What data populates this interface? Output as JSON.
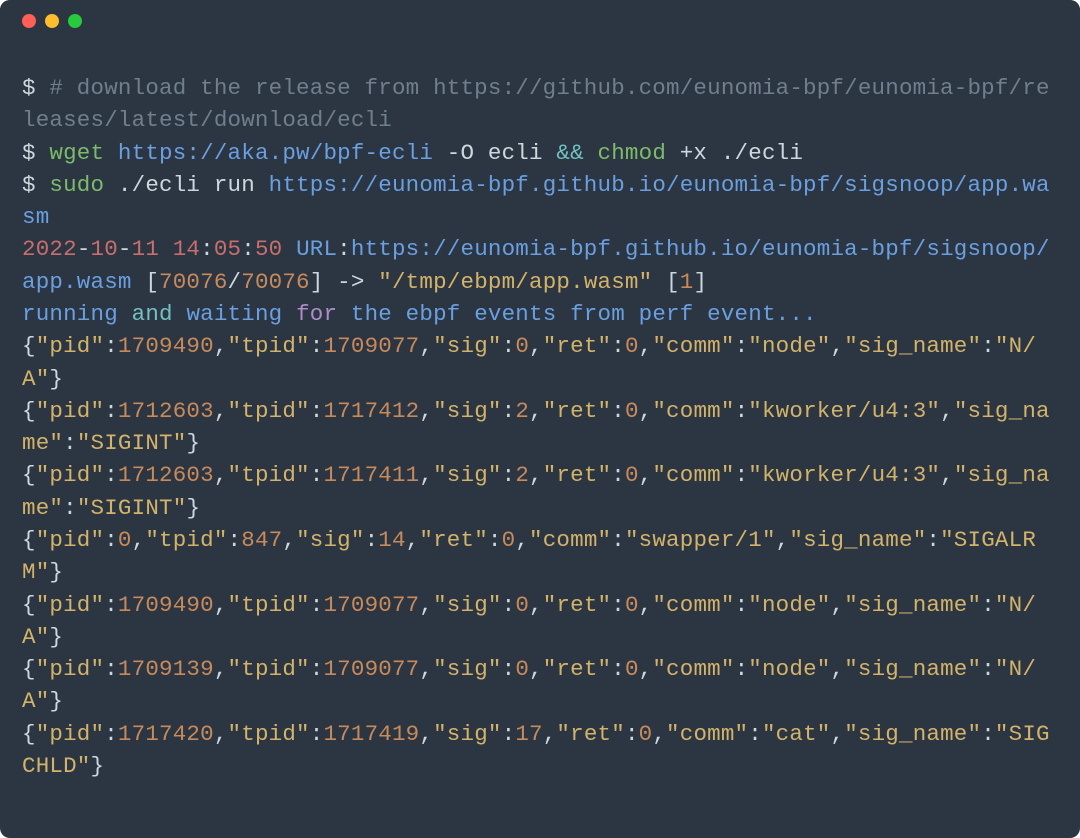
{
  "window": {
    "buttons": {
      "close": "close",
      "minimize": "minimize",
      "maximize": "maximize"
    }
  },
  "commands": {
    "prompt": "$",
    "comment": "# download the release from https://github.com/eunomia-bpf/eunomia-bpf/releases/latest/download/ecli",
    "wget": {
      "cmd": "wget",
      "url": "https://aka.pw/bpf-ecli",
      "dash_o": "-O",
      "out": "ecli",
      "amp": "&&",
      "chmod": "chmod",
      "mode": "+x",
      "path": "./ecli"
    },
    "run": {
      "sudo": "sudo",
      "ecli": "./ecli",
      "runword": "run",
      "url": "https://eunomia-bpf.github.io/eunomia-bpf/sigsnoop/app.wasm"
    }
  },
  "download_line": {
    "date_y": "2022",
    "date_m": "10",
    "date_d": "11",
    "time_h": "14",
    "time_m": "05",
    "time_s": "50",
    "label": "URL",
    "url": "https://eunomia-bpf.github.io/eunomia-bpf/sigsnoop/app.wasm",
    "size1": "70076",
    "size2": "70076",
    "arrow": "->",
    "outpath": "\"/tmp/ebpm/app.wasm\"",
    "one": "1"
  },
  "running_line": {
    "running": "running",
    "and": "and",
    "waiting": "waiting",
    "for": "for",
    "rest": "the ebpf events from perf event..."
  },
  "keys": {
    "pid": "\"pid\"",
    "tpid": "\"tpid\"",
    "sig": "\"sig\"",
    "ret": "\"ret\"",
    "comm": "\"comm\"",
    "sig_name": "\"sig_name\""
  },
  "events": [
    {
      "pid": "1709490",
      "tpid": "1709077",
      "sig": "0",
      "ret": "0",
      "comm": "\"node\"",
      "sig_name": "\"N/A\""
    },
    {
      "pid": "1712603",
      "tpid": "1717412",
      "sig": "2",
      "ret": "0",
      "comm": "\"kworker/u4:3\"",
      "sig_name": "\"SIGINT\""
    },
    {
      "pid": "1712603",
      "tpid": "1717411",
      "sig": "2",
      "ret": "0",
      "comm": "\"kworker/u4:3\"",
      "sig_name": "\"SIGINT\""
    },
    {
      "pid": "0",
      "tpid": "847",
      "sig": "14",
      "ret": "0",
      "comm": "\"swapper/1\"",
      "sig_name": "\"SIGALRM\""
    },
    {
      "pid": "1709490",
      "tpid": "1709077",
      "sig": "0",
      "ret": "0",
      "comm": "\"node\"",
      "sig_name": "\"N/A\""
    },
    {
      "pid": "1709139",
      "tpid": "1709077",
      "sig": "0",
      "ret": "0",
      "comm": "\"node\"",
      "sig_name": "\"N/A\""
    },
    {
      "pid": "1717420",
      "tpid": "1717419",
      "sig": "17",
      "ret": "0",
      "comm": "\"cat\"",
      "sig_name": "\"SIGCHLD\""
    }
  ]
}
